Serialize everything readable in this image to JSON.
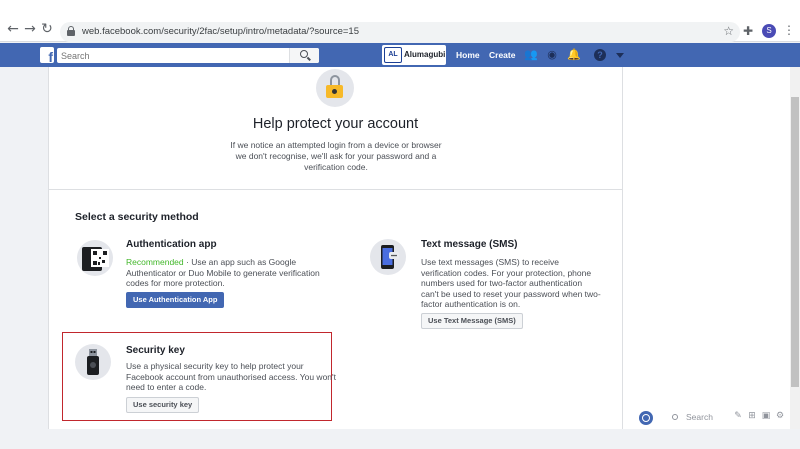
{
  "browser": {
    "url": "web.facebook.com/security/2fac/setup/intro/metadata/?source=15",
    "profile_initial": "S",
    "icons": [
      "back-arrow-icon",
      "forward-arrow-icon",
      "reload-icon",
      "lock-icon",
      "star-icon",
      "extensions-icon",
      "menu-icon"
    ]
  },
  "fbbar": {
    "search_placeholder": "Search",
    "profile_badge": "AL",
    "profile_name": "Alumagubi",
    "nav": {
      "home": "Home",
      "create": "Create"
    },
    "icons": [
      "friends-icon",
      "messenger-icon",
      "notifications-icon",
      "help-icon",
      "account-caret-icon"
    ],
    "brand_color": "#4267b2"
  },
  "page": {
    "title": "Help protect your account",
    "description": "If we notice an attempted login from a device or browser we don't recognise, we'll ask for your password and a verification code.",
    "section_title": "Select a security method",
    "methods": [
      {
        "title": "Authentication app",
        "recommended": "Recommended",
        "description": " · Use an app such as Google Authenticator or Duo Mobile to generate verification codes for more protection.",
        "button": "Use Authentication App"
      },
      {
        "title": "Text message (SMS)",
        "description": "Use text messages (SMS) to receive verification codes. For your protection, phone numbers used for two-factor authentication can't be used to reset your password when two-factor authentication is on.",
        "button": "Use Text Message (SMS)"
      },
      {
        "title": "Security key",
        "description": "Use a physical security key to help protect your Facebook account from unauthorised access. You won't need to enter a code.",
        "button": "Use security key"
      }
    ],
    "highlight_color": "#c1272d"
  },
  "chat": {
    "search_placeholder": "Search"
  }
}
